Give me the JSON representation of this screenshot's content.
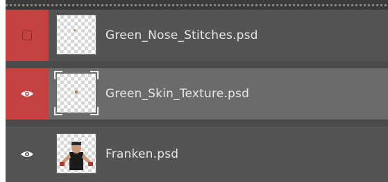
{
  "layers": [
    {
      "name": "Green_Nose_Stitches.psd",
      "visible": false,
      "selected": false,
      "thumbnail_icon": "transparent-layer-thumbnail"
    },
    {
      "name": "Green_Skin_Texture.psd",
      "visible": true,
      "selected": true,
      "thumbnail_icon": "transparent-layer-thumbnail"
    },
    {
      "name": "Franken.psd",
      "visible": true,
      "selected": false,
      "thumbnail_icon": "person-photo-thumbnail"
    }
  ],
  "colors": {
    "panel_bg": "#535353",
    "selected_row_bg": "#6b6b6b",
    "visibility_highlight": "#c4413f",
    "text": "#e6e6e6"
  },
  "icons": {
    "visibility": "eye-icon",
    "hidden_visibility": "empty-visibility-box"
  }
}
